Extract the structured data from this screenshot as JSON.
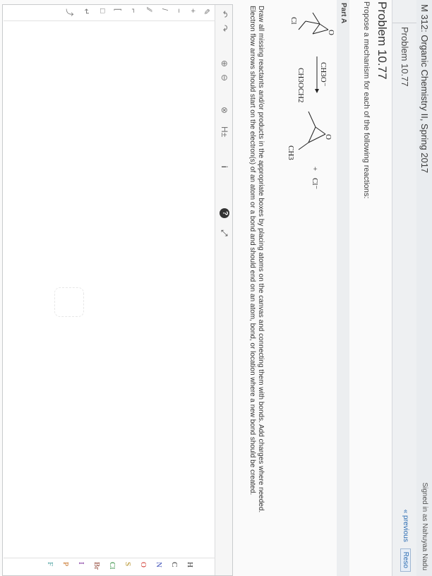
{
  "header": {
    "course_title": "M 312: Organic Chemistry II, Spring 2017",
    "signed_in": "Signed in as Nahuyaa Nadu"
  },
  "breadcrumb": {
    "label": "Problem 10.77",
    "previous_label": "« previous",
    "reset_label": "Reso"
  },
  "problem": {
    "title": "Problem 10.77",
    "description": "Propose a mechanism for each of the following reactions:",
    "part_label": "Part A"
  },
  "reaction": {
    "reactant_substituent": "Cl",
    "reagent": "CH3O⁻",
    "solvent": "CH3OCH2",
    "product_substituent": "CH3",
    "oxygen": "O",
    "plus": "+",
    "byproduct": "Cl⁻"
  },
  "instructions": {
    "text": "Draw all missing reactants and/or products in the appropriate boxes by placing atoms on the canvas and connecting them with bonds. Add charges where needed. Electron flow arrows should start on the electron(s) of an atom or a bond and should end on an atom, bond, or location where a new bond should be created."
  },
  "toolbar": {
    "undo": "↶",
    "redo": "↷",
    "zoom_in": "⊕",
    "zoom_out": "⊖",
    "clear": "⊗",
    "hydrogen": "H±",
    "info": "i",
    "help": "?",
    "expand": "⤢"
  },
  "left_tools": [
    "✎",
    "+",
    "−",
    "/",
    "⁄⁄",
    "⌐",
    "[",
    "□",
    "↵",
    "⤴"
  ],
  "elements": [
    "H",
    "C",
    "N",
    "O",
    "S",
    "Cl",
    "Br",
    "I",
    "P",
    "F"
  ]
}
